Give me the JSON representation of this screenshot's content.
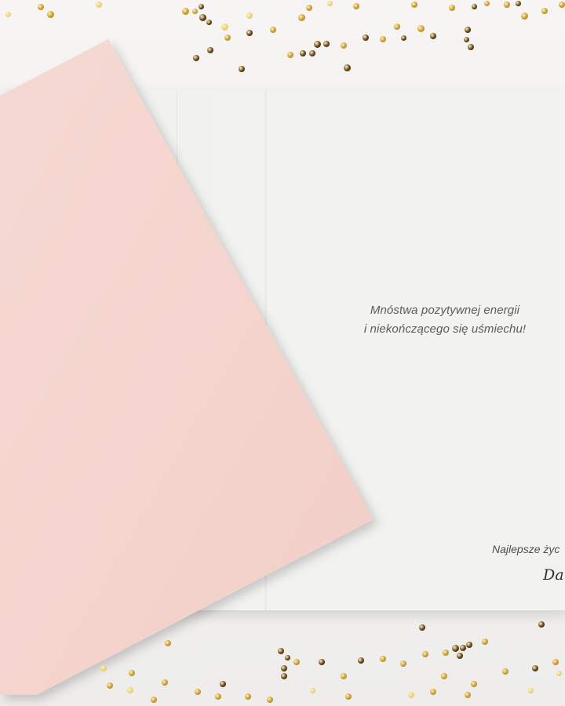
{
  "card": {
    "message_line1": "Mnóstwa pozytywnej energii",
    "message_line2": "i niekończącego się uśmiechu!",
    "closing": "Najlepsze życ",
    "signature": "Da"
  },
  "colors": {
    "background": "#f3f2f0",
    "card_paper": "#f2f2f0",
    "envelope_pink": "#f5d6d0",
    "confetti_gold": "#c8962b",
    "confetti_brown": "#5a3a12"
  },
  "objects": {
    "envelope": "pink-envelope",
    "card": "open-greeting-card",
    "decoration": "gold-confetti"
  }
}
